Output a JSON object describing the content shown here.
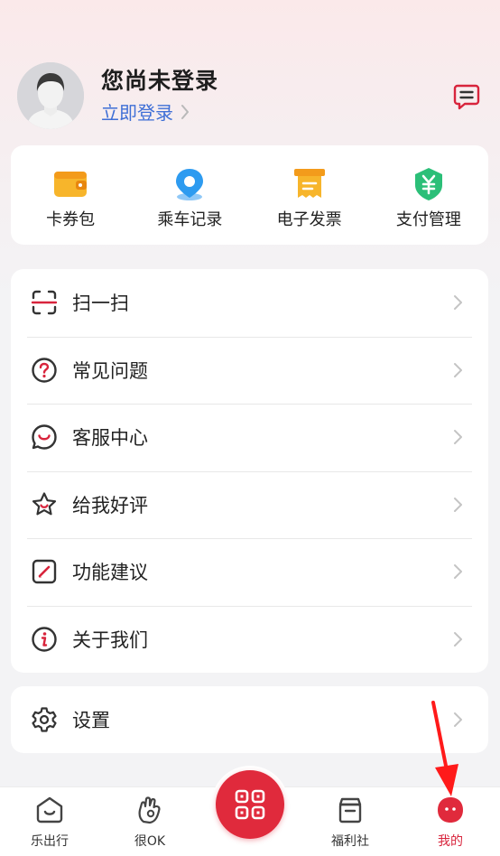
{
  "header": {
    "user_name": "您尚未登录",
    "login_label": "立即登录"
  },
  "quick_actions": [
    {
      "label": "卡券包",
      "icon": "wallet-icon"
    },
    {
      "label": "乘车记录",
      "icon": "location-pin-icon"
    },
    {
      "label": "电子发票",
      "icon": "invoice-icon"
    },
    {
      "label": "支付管理",
      "icon": "yuan-shield-icon"
    }
  ],
  "menu": [
    {
      "label": "扫一扫",
      "icon": "scan-icon"
    },
    {
      "label": "常见问题",
      "icon": "question-icon"
    },
    {
      "label": "客服中心",
      "icon": "chat-smile-icon"
    },
    {
      "label": "给我好评",
      "icon": "star-icon"
    },
    {
      "label": "功能建议",
      "icon": "edit-icon"
    },
    {
      "label": "关于我们",
      "icon": "info-icon"
    }
  ],
  "settings": {
    "label": "设置",
    "icon": "gear-icon"
  },
  "tabbar": [
    {
      "label": "乐出行",
      "icon": "home-smile-icon"
    },
    {
      "label": "很OK",
      "icon": "ok-hand-icon"
    },
    {
      "label": "",
      "icon": "qr-code-icon"
    },
    {
      "label": "福利社",
      "icon": "gift-box-icon"
    },
    {
      "label": "我的",
      "icon": "profile-face-icon",
      "active": true
    }
  ],
  "colors": {
    "accent": "#e02a3c",
    "link": "#3f6fd6",
    "wallet": "#f5a623",
    "pin": "#2d9bf0",
    "invoice": "#f5a623",
    "pay": "#2bbf78"
  }
}
